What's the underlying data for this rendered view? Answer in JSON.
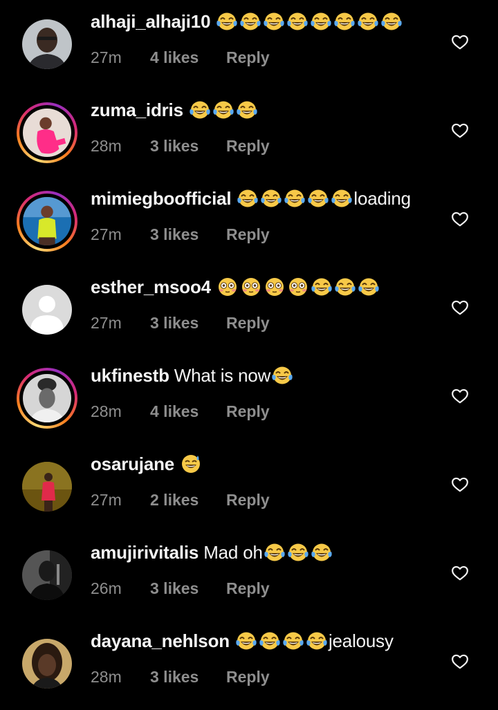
{
  "comments": [
    {
      "username": "alhaji_alhaji10",
      "text_before": "",
      "emojis": [
        "laugh",
        "laugh",
        "laugh",
        "laugh",
        "laugh",
        "laugh",
        "laugh",
        "laugh"
      ],
      "text_after": "",
      "time": "27m",
      "likes": "4 likes",
      "reply": "Reply",
      "story_ring": false,
      "avatar": "man-selfie"
    },
    {
      "username": "zuma_idris",
      "text_before": "",
      "emojis": [
        "laugh",
        "laugh",
        "laugh"
      ],
      "text_after": "",
      "time": "28m",
      "likes": "3 likes",
      "reply": "Reply",
      "story_ring": true,
      "avatar": "woman-pink"
    },
    {
      "username": "mimiegboofficial",
      "text_before": "",
      "emojis": [
        "laugh",
        "laugh",
        "laugh",
        "laugh",
        "laugh"
      ],
      "text_after": "loading",
      "time": "27m",
      "likes": "3 likes",
      "reply": "Reply",
      "story_ring": true,
      "avatar": "woman-yellow"
    },
    {
      "username": "esther_msoo4",
      "text_before": "",
      "emojis": [
        "flushed",
        "flushed",
        "flushed",
        "flushed",
        "laugh",
        "laugh",
        "laugh"
      ],
      "text_after": "",
      "time": "27m",
      "likes": "3 likes",
      "reply": "Reply",
      "story_ring": false,
      "avatar": "default"
    },
    {
      "username": "ukfinestb",
      "text_before": "What is now",
      "emojis": [
        "laugh"
      ],
      "text_after": "",
      "time": "28m",
      "likes": "4 likes",
      "reply": "Reply",
      "story_ring": true,
      "avatar": "woman-bw"
    },
    {
      "username": "osarujane",
      "text_before": "",
      "emojis": [
        "sweat-smile"
      ],
      "text_after": "",
      "time": "27m",
      "likes": "2 likes",
      "reply": "Reply",
      "story_ring": false,
      "avatar": "woman-red"
    },
    {
      "username": "amujirivitalis",
      "text_before": "Mad oh",
      "emojis": [
        "laugh",
        "laugh",
        "laugh"
      ],
      "text_after": "",
      "time": "26m",
      "likes": "3 likes",
      "reply": "Reply",
      "story_ring": false,
      "avatar": "man-bw"
    },
    {
      "username": "dayana_nehlson",
      "text_before": "",
      "emojis": [
        "laugh",
        "laugh",
        "laugh",
        "laugh"
      ],
      "text_after": "jealousy",
      "time": "28m",
      "likes": "3 likes",
      "reply": "Reply",
      "story_ring": false,
      "avatar": "woman-dark"
    }
  ],
  "colors": {
    "background": "#000000",
    "text": "#f5f5f5",
    "secondary": "#8e8e8e"
  },
  "icons": {
    "like": "heart-outline-icon",
    "laugh": "face-with-tears-of-joy",
    "flushed": "flushed-face",
    "sweat-smile": "grinning-face-with-sweat"
  }
}
